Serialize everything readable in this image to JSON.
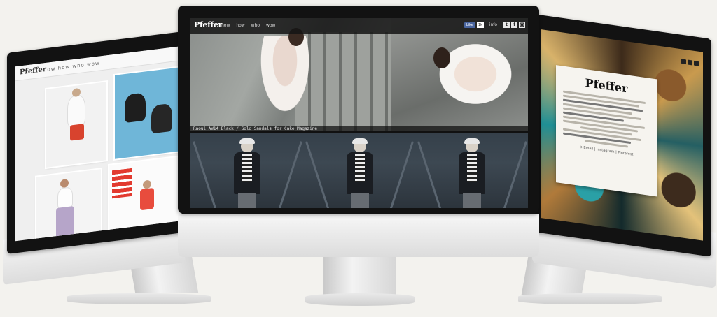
{
  "center_screen": {
    "logo": "Pfeffer",
    "nav": [
      "now",
      "how",
      "who",
      "wow"
    ],
    "social": {
      "like_label": "Like",
      "like_count": "1k",
      "info_label": "info"
    },
    "caption": "Raoul AW14 Black / Gold Sandals for Cake Magazine"
  },
  "left_screen": {
    "logo": "Pfeffer",
    "nav": "now how who wow"
  },
  "right_screen": {
    "card_logo": "Pfeffer",
    "links": "⊙ Email | Instagram | Pinterest"
  },
  "colors": {
    "background": "#f3f2ee",
    "bezel": "#121212",
    "facebook": "#4a66a0"
  },
  "icons": [
    "twitter-icon",
    "facebook-icon",
    "instagram-icon"
  ]
}
